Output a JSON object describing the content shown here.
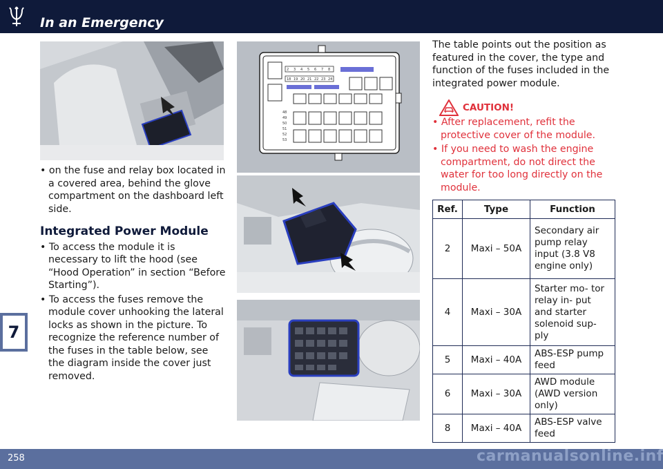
{
  "header": {
    "title": "In an Emergency"
  },
  "chapter": "7",
  "page_number": "258",
  "watermark": "carmanualsonline.info",
  "left_column": {
    "bullet_glove": "on the fuse and relay box located in a covered area, behind the glove compartment on the dashboard left side.",
    "section_title": "Integrated Power Module",
    "bullet_hood": "To access the module it is necessary to lift the hood (see “Hood Operation” in section “Before Starting”).",
    "bullet_cover": "To access the fuses remove the module cover unhooking the lateral locks as shown in the picture. To recognize the reference number of the fuses in the table below, see the diagram inside the cover just removed."
  },
  "fuse_diagram": {
    "top_row": [
      "2",
      "3",
      "4",
      "5",
      "6",
      "7",
      "8"
    ],
    "second_row": [
      "18",
      "19",
      "20",
      "21",
      "22",
      "23",
      "24"
    ],
    "side_column": [
      "48",
      "49",
      "50",
      "51",
      "52",
      "53"
    ]
  },
  "right_column": {
    "intro": "The table points out the position as featured in the cover, the type and function of the fuses included in the integrated power module.",
    "caution_title": "CAUTION!",
    "caution_items": [
      "After replacement, refit the protective cover of the module.",
      "If you need to wash the engine compartment, do not direct the water for too long directly on the module."
    ]
  },
  "fuse_table": {
    "headers": [
      "Ref.",
      "Type",
      "Function"
    ],
    "rows": [
      {
        "ref": "2",
        "type": "Maxi – 50A",
        "function": "Secondary air pump relay input (3.8 V8 engine only)"
      },
      {
        "ref": "4",
        "type": "Maxi – 30A",
        "function": "Starter mo- tor relay in- put and starter solenoid sup- ply"
      },
      {
        "ref": "5",
        "type": "Maxi – 40A",
        "function": "ABS-ESP pump feed"
      },
      {
        "ref": "6",
        "type": "Maxi – 30A",
        "function": "AWD module (AWD version only)"
      },
      {
        "ref": "8",
        "type": "Maxi – 40A",
        "function": "ABS-ESP valve feed"
      }
    ]
  },
  "colors": {
    "navy": "#0f1a3a",
    "band": "#5b6f9e",
    "caution_red": "#e0313b",
    "highlight_blue": "#2a3fbf"
  }
}
